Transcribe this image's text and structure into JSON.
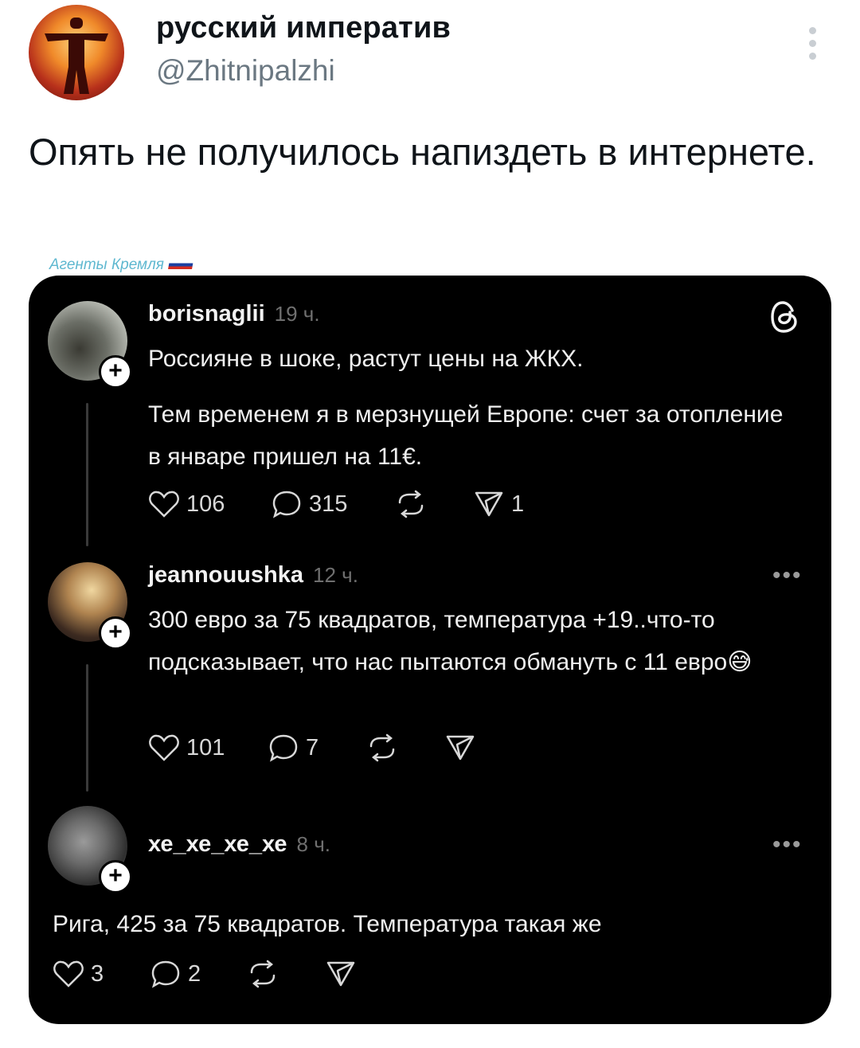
{
  "tweet": {
    "author_name": "русский императив",
    "author_handle": "@Zhitnipalzhi",
    "text": "Опять не получилось напиздеть в интернете.",
    "watermark": "Агенты Кремля"
  },
  "threads": [
    {
      "username": "borisnaglii",
      "time": "19 ч.",
      "paragraphs": [
        "Россияне в шоке, растут цены на ЖКХ.",
        "Тем временем я в мерзнущей Европе: счет за отопление в январе пришел на 11€."
      ],
      "likes": "106",
      "replies": "315",
      "shares": "1"
    },
    {
      "username": "jeannouushka",
      "time": "12 ч.",
      "text": "300 евро за 75 квадратов, температура +19..что-то подсказывает, что нас пытаются обмануть с 11 евро",
      "emoji": "😅",
      "likes": "101",
      "replies": "7"
    },
    {
      "username": "хе_хе_хе_хе",
      "time": "8 ч.",
      "text": "Рига, 425 за 75 квадратов. Температура  такая же",
      "likes": "3",
      "replies": "2"
    }
  ],
  "icons": {
    "follow_plus": "+",
    "more": "•••",
    "threads_logo": "threads-logo"
  }
}
